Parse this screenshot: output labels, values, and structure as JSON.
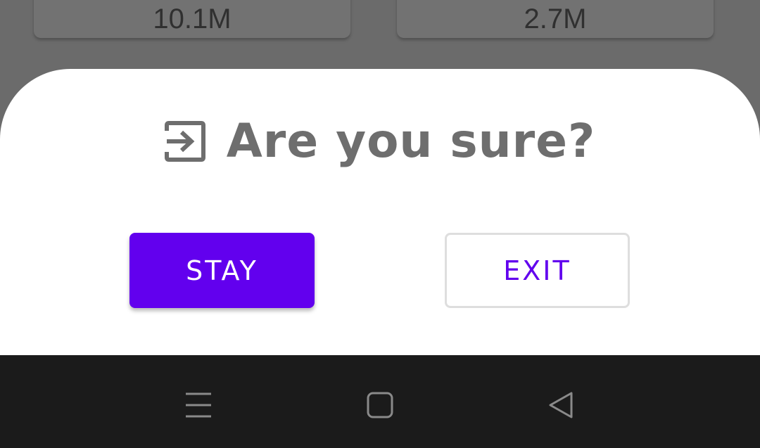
{
  "background": {
    "stat_left": "10.1M",
    "stat_right": "2.7M"
  },
  "dialog": {
    "icon": "exit-to-app-icon",
    "title": "Are you sure?",
    "stay_label": "STAY",
    "exit_label": "EXIT"
  },
  "navbar": {
    "icons": [
      "menu-icon",
      "home-square-icon",
      "back-triangle-icon"
    ]
  },
  "colors": {
    "accent": "#6200ee",
    "title_text": "#6e6e6e",
    "nav_background": "#1b1b1b",
    "scrim": "#6b6b6b"
  }
}
